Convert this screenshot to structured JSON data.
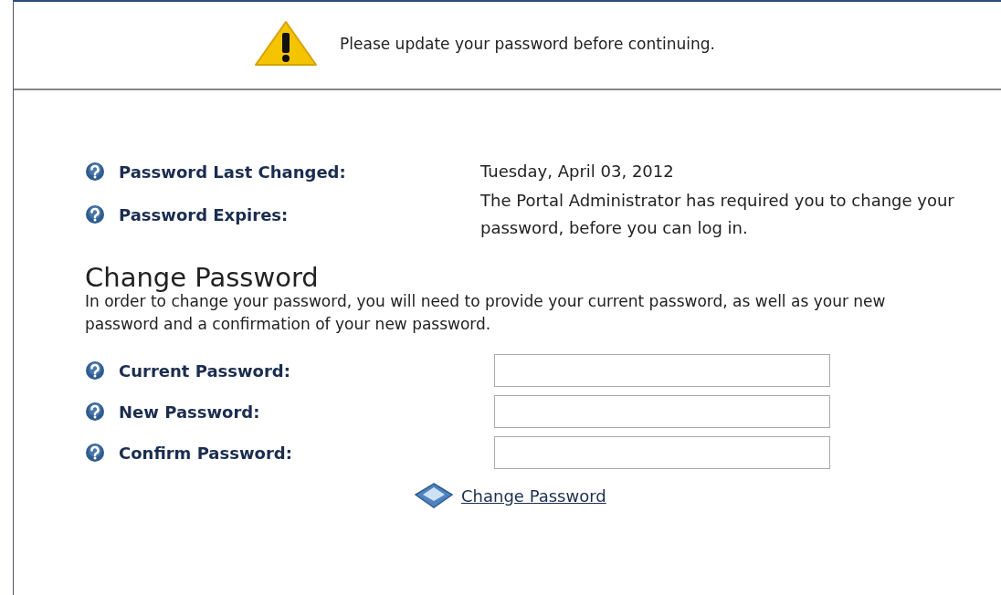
{
  "notice": {
    "message": "Please update your password before continuing."
  },
  "info": [
    {
      "label": "Password Last Changed:",
      "value": "Tuesday, April 03, 2012"
    },
    {
      "label": "Password Expires:",
      "value": "The Portal Administrator has required you to change your password, before you can log in."
    }
  ],
  "change_password": {
    "heading": "Change Password",
    "description": "In order to change your password, you will need to provide your current password, as well as your new password and a confirmation of your new password.",
    "fields": [
      {
        "label": "Current Password:"
      },
      {
        "label": "New Password:"
      },
      {
        "label": "Confirm Password:"
      }
    ],
    "submit_link": "Change Password"
  }
}
